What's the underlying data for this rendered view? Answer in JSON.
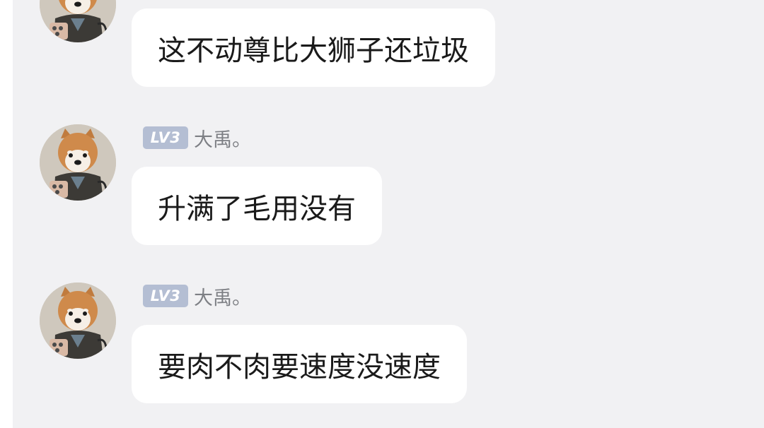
{
  "messages": [
    {
      "avatar_icon": "shiba-dog-avatar-icon",
      "text": "这不动尊比大狮子还垃圾"
    },
    {
      "avatar_icon": "shiba-dog-avatar-icon",
      "level": "LV3",
      "nickname": "大禹。",
      "text": "升满了毛用没有"
    },
    {
      "avatar_icon": "shiba-dog-avatar-icon",
      "level": "LV3",
      "nickname": "大禹。",
      "text": "要肉不肉要速度没速度"
    }
  ],
  "colors": {
    "chat_background": "#f1f1f3",
    "bubble_background": "#ffffff",
    "level_badge": "#b4bed3",
    "nickname_text": "#7d7f84",
    "message_text": "#1a1a1a"
  }
}
